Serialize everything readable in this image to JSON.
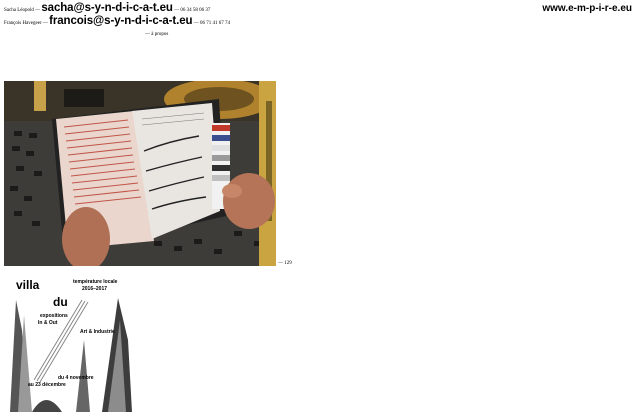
{
  "contacts": [
    {
      "name": "Sacha Léopold",
      "sep": "—",
      "email": "sacha@s-y-n-d-i-c-a-t.eu",
      "phone": "— 06 34 58 06 37"
    },
    {
      "name": "François Havegeer",
      "sep": "—",
      "email": "francois@s-y-n-d-i-c-a-t.eu",
      "phone": "— 06 71 41 67 74"
    }
  ],
  "brand": "www.e-m-p-i-r-e.eu",
  "apropos": "— à propos",
  "photo": {
    "count": "— 129"
  },
  "poster": {
    "title_villa": "villa",
    "title_du": "du",
    "temp_title": "température locale",
    "years": "2016–2017",
    "expo1": "expositions",
    "expo2": "In & Out",
    "art": "Art & Industrie",
    "date1": "du 4 novembre",
    "date2": "au 23 décembre"
  }
}
